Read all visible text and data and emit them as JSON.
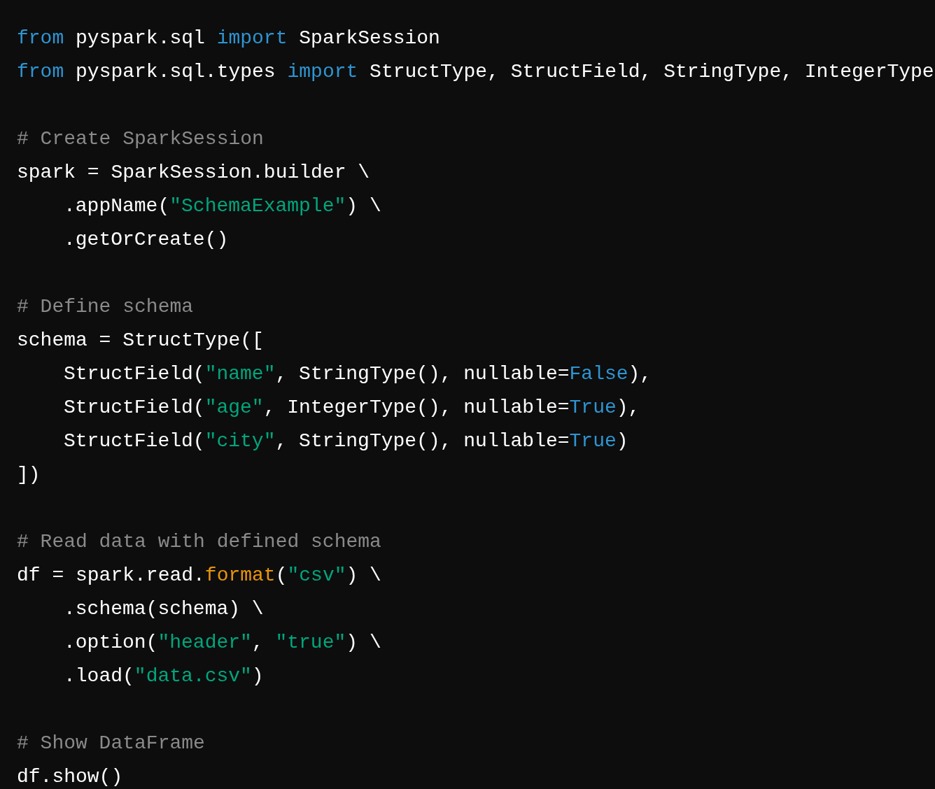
{
  "code_blocks": [
    {
      "lines": [
        {
          "tokens": [
            {
              "kind": "keyword",
              "text": "from"
            },
            {
              "kind": "plain",
              "text": " pyspark.sql "
            },
            {
              "kind": "keyword",
              "text": "import"
            },
            {
              "kind": "plain",
              "text": " SparkSession"
            }
          ]
        },
        {
          "tokens": [
            {
              "kind": "keyword",
              "text": "from"
            },
            {
              "kind": "plain",
              "text": " pyspark.sql.types "
            },
            {
              "kind": "keyword",
              "text": "import"
            },
            {
              "kind": "plain",
              "text": " StructType, StructField, StringType, IntegerType"
            }
          ]
        }
      ]
    },
    {
      "lines": [
        {
          "tokens": [
            {
              "kind": "comment",
              "text": "# Create SparkSession"
            }
          ]
        },
        {
          "tokens": [
            {
              "kind": "plain",
              "text": "spark = SparkSession.builder \\"
            }
          ],
          "children": [
            {
              "tokens": [
                {
                  "kind": "plain",
                  "text": ".appName("
                },
                {
                  "kind": "string",
                  "text": "\"SchemaExample\""
                },
                {
                  "kind": "plain",
                  "text": ") \\"
                }
              ]
            },
            {
              "tokens": [
                {
                  "kind": "plain",
                  "text": ".getOrCreate()"
                }
              ]
            }
          ]
        }
      ]
    },
    {
      "lines": [
        {
          "tokens": [
            {
              "kind": "comment",
              "text": "# Define schema"
            }
          ]
        },
        {
          "tokens": [
            {
              "kind": "plain",
              "text": "schema = StructType(["
            }
          ],
          "children": [
            {
              "tokens": [
                {
                  "kind": "plain",
                  "text": "StructField("
                },
                {
                  "kind": "string",
                  "text": "\"name\""
                },
                {
                  "kind": "plain",
                  "text": ", StringType(), nullable="
                },
                {
                  "kind": "keyword",
                  "text": "False"
                },
                {
                  "kind": "plain",
                  "text": "),"
                }
              ]
            },
            {
              "tokens": [
                {
                  "kind": "plain",
                  "text": "StructField("
                },
                {
                  "kind": "string",
                  "text": "\"age\""
                },
                {
                  "kind": "plain",
                  "text": ", IntegerType(), nullable="
                },
                {
                  "kind": "keyword",
                  "text": "True"
                },
                {
                  "kind": "plain",
                  "text": "),"
                }
              ]
            },
            {
              "tokens": [
                {
                  "kind": "plain",
                  "text": "StructField("
                },
                {
                  "kind": "string",
                  "text": "\"city\""
                },
                {
                  "kind": "plain",
                  "text": ", StringType(), nullable="
                },
                {
                  "kind": "keyword",
                  "text": "True"
                },
                {
                  "kind": "plain",
                  "text": ")"
                }
              ]
            }
          ]
        },
        {
          "tokens": [
            {
              "kind": "plain",
              "text": "])"
            }
          ]
        }
      ]
    },
    {
      "lines": [
        {
          "tokens": [
            {
              "kind": "comment",
              "text": "# Read data with defined schema"
            }
          ]
        },
        {
          "tokens": [
            {
              "kind": "plain",
              "text": "df = spark.read."
            },
            {
              "kind": "function",
              "text": "format"
            },
            {
              "kind": "plain",
              "text": "("
            },
            {
              "kind": "string",
              "text": "\"csv\""
            },
            {
              "kind": "plain",
              "text": ") \\"
            }
          ],
          "children": [
            {
              "tokens": [
                {
                  "kind": "plain",
                  "text": ".schema(schema) \\"
                }
              ]
            },
            {
              "tokens": [
                {
                  "kind": "plain",
                  "text": ".option("
                },
                {
                  "kind": "string",
                  "text": "\"header\""
                },
                {
                  "kind": "plain",
                  "text": ", "
                },
                {
                  "kind": "string",
                  "text": "\"true\""
                },
                {
                  "kind": "plain",
                  "text": ") \\"
                }
              ]
            },
            {
              "tokens": [
                {
                  "kind": "plain",
                  "text": ".load("
                },
                {
                  "kind": "string",
                  "text": "\"data.csv\""
                },
                {
                  "kind": "plain",
                  "text": ")"
                }
              ]
            }
          ]
        }
      ]
    },
    {
      "lines": [
        {
          "tokens": [
            {
              "kind": "comment",
              "text": "# Show DataFrame"
            }
          ]
        },
        {
          "tokens": [
            {
              "kind": "plain",
              "text": "df.show()"
            }
          ]
        }
      ]
    }
  ]
}
